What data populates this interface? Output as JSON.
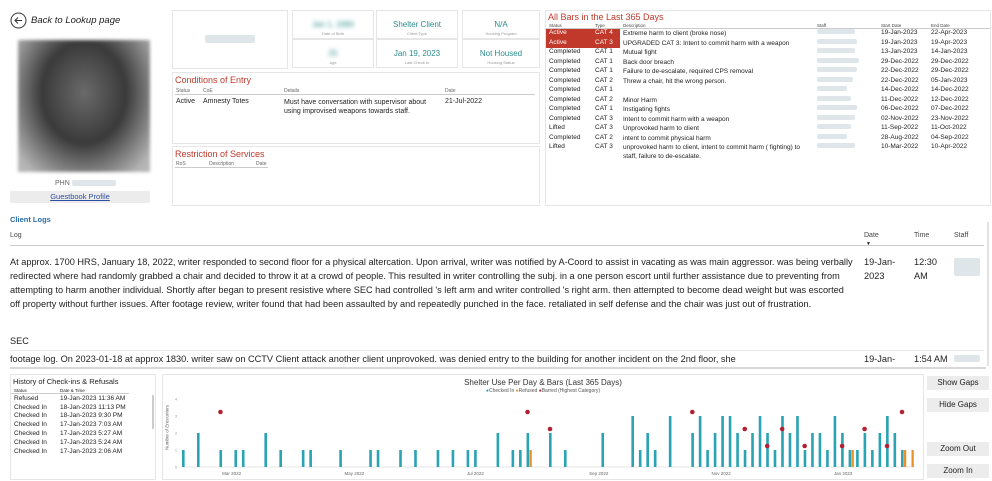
{
  "nav": {
    "back_label": "Back to Lookup page"
  },
  "profile": {
    "phn_label": "PHN",
    "guestbook_link": "Guestbook Profile"
  },
  "kpis": [
    {
      "value": "Jan 1, 1990",
      "label": "Date of Birth"
    },
    {
      "value": "Shelter Client",
      "label": "Client Type"
    },
    {
      "value": "N/A",
      "label": "Housing Program"
    },
    {
      "value": "25",
      "label": "Age"
    },
    {
      "value": "Jan 19, 2023",
      "label": "Last Check In"
    },
    {
      "value": "Not Housed",
      "label": "Housing Status"
    }
  ],
  "conditions": {
    "title": "Conditions of Entry",
    "headers": [
      "Status",
      "CoE",
      "Details",
      "Date"
    ],
    "rows": [
      {
        "status": "Active",
        "coe": "Amnesty Totes",
        "details": "Must have conversation with supervisor about using improvised weapons towards staff.",
        "date": "21-Jul-2022"
      }
    ]
  },
  "restrictions": {
    "title": "Restriction of Services",
    "headers": [
      "RoS",
      "Description",
      "Date"
    ]
  },
  "bars": {
    "title": "All Bars in the Last 365 Days",
    "headers": [
      "Status",
      "Type",
      "Description",
      "Staff",
      "Start Date",
      "End Date"
    ],
    "rows": [
      {
        "status": "Active",
        "type": "CAT 4",
        "desc": "Extreme harm to client (broke nose)",
        "start": "19-Jan-2023",
        "end": "22-Apr-2023"
      },
      {
        "status": "Active",
        "type": "CAT 3",
        "desc": "UPGRADED CAT 3: Intent to commit harm with a weapon",
        "start": "19-Jan-2023",
        "end": "19-Apr-2023"
      },
      {
        "status": "Completed",
        "type": "CAT 1",
        "desc": "Mutual fight",
        "start": "13-Jan-2023",
        "end": "14-Jan-2023"
      },
      {
        "status": "Completed",
        "type": "CAT 1",
        "desc": "Back door breach",
        "start": "29-Dec-2022",
        "end": "29-Dec-2022"
      },
      {
        "status": "Completed",
        "type": "CAT 1",
        "desc": "Failure to de-escalate, required CPS removal",
        "start": "22-Dec-2022",
        "end": "29-Dec-2022"
      },
      {
        "status": "Completed",
        "type": "CAT 2",
        "desc": "Threw a chair, hit the wrong person.",
        "start": "22-Dec-2022",
        "end": "05-Jan-2023"
      },
      {
        "status": "Completed",
        "type": "CAT 1",
        "desc": "",
        "start": "14-Dec-2022",
        "end": "14-Dec-2022"
      },
      {
        "status": "Completed",
        "type": "CAT 2",
        "desc": "Minor Harm",
        "start": "11-Dec-2022",
        "end": "12-Dec-2022"
      },
      {
        "status": "Completed",
        "type": "CAT 1",
        "desc": "Instigating fights",
        "start": "06-Dec-2022",
        "end": "07-Dec-2022"
      },
      {
        "status": "Completed",
        "type": "CAT 3",
        "desc": "Intent to commit harm with a weapon",
        "start": "02-Nov-2022",
        "end": "23-Nov-2022"
      },
      {
        "status": "Lifted",
        "type": "CAT 3",
        "desc": "Unprovoked harm to client",
        "start": "11-Sep-2022",
        "end": "11-Oct-2022"
      },
      {
        "status": "Completed",
        "type": "CAT 2",
        "desc": "intent to commit physical harm",
        "start": "28-Aug-2022",
        "end": "04-Sep-2022"
      },
      {
        "status": "Lifted",
        "type": "CAT 3",
        "desc": "unprovoked harm to client, intent to commit harm ( fighting) to staff, failure to de-escalate.",
        "start": "10-Mar-2022",
        "end": "10-Apr-2022"
      }
    ]
  },
  "logs": {
    "title": "Client Logs",
    "headers": {
      "log": "Log",
      "date": "Date",
      "time": "Time",
      "staff": "Staff"
    },
    "entry1_text": "At approx. 1700 HRS, January 18, 2022, writer responded to second floor for a physical altercation. Upon arrival, writer was notified by A-Coord to assist in vacating as was main aggressor. was being verbally redirected where had randomly grabbed a chair and decided to throw it at a crowd of people. This resulted in writer controlling the subj. in a one person escort until further assistance due to preventing from attempting to harm another individual. Shortly after began to present resistive where SEC had controlled 's left arm and writer controlled 's right arm. then attempted to become dead weight but was escorted off property without further issues. After footage review, writer found that had been assaulted by and repeatedly punched in the face. retaliated in self defense and the chair was just out of frustration.",
    "entry1_extra": "SEC",
    "entry1_date": "19-Jan-2023",
    "entry1_time": "12:30 AM",
    "entry2_text": "footage log. On 2023-01-18 at approx 1830. writer saw on CCTV Client attack another client unprovoked. was denied entry to the building for another incident on the 2nd floor, she",
    "entry2_date": "19-Jan-",
    "entry2_time": "1:54 AM"
  },
  "checkins": {
    "title": "History of Check-ins & Refusals",
    "headers": [
      "Status",
      "Date & Time"
    ],
    "rows": [
      {
        "status": "Refused",
        "dt": "19-Jan-2023 11:36 AM"
      },
      {
        "status": "Checked In",
        "dt": "18-Jan-2023 11:13 PM"
      },
      {
        "status": "Checked In",
        "dt": "18-Jan-2023 9:30 PM"
      },
      {
        "status": "Checked In",
        "dt": "17-Jan-2023 7:03 AM"
      },
      {
        "status": "Checked In",
        "dt": "17-Jan-2023 5:27 AM"
      },
      {
        "status": "Checked In",
        "dt": "17-Jan-2023 5:24 AM"
      },
      {
        "status": "Checked In",
        "dt": "17-Jan-2023 2:06 AM"
      }
    ]
  },
  "chart_data": {
    "type": "bar",
    "title": "Shelter Use Per Day & Bars (Last 365 Days)",
    "ylabel": "Number of Encounters",
    "legend": [
      "Checked In",
      "Refused",
      "Barred (Highest Category)"
    ],
    "legend_colors": [
      "#2aa3b5",
      "#e8902a",
      "#b22234"
    ],
    "x_ticks": [
      "Mar 2022",
      "May 2022",
      "Jul 2022",
      "Sep 2022",
      "Nov 2022",
      "Jan 2023"
    ],
    "ylim": [
      0,
      4
    ],
    "bars_checked_in": [
      1,
      0,
      2,
      0,
      0,
      1,
      0,
      1,
      1,
      0,
      0,
      2,
      0,
      1,
      0,
      0,
      1,
      1,
      0,
      0,
      0,
      1,
      0,
      0,
      0,
      1,
      1,
      0,
      0,
      1,
      0,
      1,
      0,
      0,
      1,
      0,
      1,
      0,
      1,
      1,
      0,
      0,
      2,
      0,
      1,
      1,
      2,
      0,
      0,
      2,
      0,
      1,
      0,
      0,
      0,
      0,
      2,
      0,
      0,
      0,
      3,
      1,
      2,
      1,
      0,
      3,
      0,
      0,
      2,
      3,
      1,
      2,
      3,
      3,
      2,
      1,
      2,
      3,
      2,
      1,
      3,
      2,
      3,
      1,
      2,
      2,
      1,
      3,
      2,
      1,
      1,
      2,
      1,
      2,
      3,
      2,
      1,
      0
    ],
    "bars_refused": [
      0,
      0,
      0,
      0,
      0,
      0,
      0,
      0,
      0,
      0,
      0,
      0,
      0,
      0,
      0,
      0,
      0,
      0,
      0,
      0,
      0,
      0,
      0,
      0,
      0,
      0,
      0,
      0,
      0,
      0,
      0,
      0,
      0,
      0,
      0,
      0,
      0,
      0,
      0,
      0,
      0,
      0,
      0,
      0,
      0,
      0,
      1,
      0,
      0,
      0,
      0,
      0,
      0,
      0,
      0,
      0,
      0,
      0,
      0,
      0,
      0,
      0,
      0,
      0,
      0,
      0,
      0,
      0,
      0,
      0,
      0,
      0,
      0,
      0,
      0,
      0,
      0,
      0,
      0,
      0,
      0,
      0,
      0,
      0,
      0,
      0,
      0,
      0,
      0,
      1,
      0,
      0,
      0,
      0,
      0,
      0,
      1,
      1
    ],
    "bar_markers": [
      {
        "i": 5,
        "level": 3
      },
      {
        "i": 46,
        "level": 3
      },
      {
        "i": 49,
        "level": 2
      },
      {
        "i": 68,
        "level": 3
      },
      {
        "i": 75,
        "level": 2
      },
      {
        "i": 78,
        "level": 1
      },
      {
        "i": 80,
        "level": 2
      },
      {
        "i": 83,
        "level": 1
      },
      {
        "i": 88,
        "level": 1
      },
      {
        "i": 91,
        "level": 2
      },
      {
        "i": 94,
        "level": 1
      },
      {
        "i": 96,
        "level": 3
      }
    ]
  },
  "buttons": {
    "show_gaps": "Show Gaps",
    "hide_gaps": "Hide Gaps",
    "zoom_out": "Zoom Out",
    "zoom_in": "Zoom In"
  }
}
